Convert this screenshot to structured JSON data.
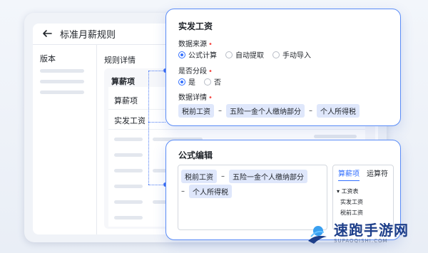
{
  "app": {
    "title": "标准月薪规则",
    "left_column_title": "版本",
    "rule_detail_title": "规则详情",
    "salary_items_title": "算薪项",
    "rows": [
      "算薪项",
      "实发工资"
    ]
  },
  "pay_panel": {
    "title": "实发工资",
    "data_source_label": "数据来源",
    "data_source_options": [
      "公式计算",
      "自动提取",
      "手动导入"
    ],
    "data_source_selected": "公式计算",
    "segmented_label": "是否分段",
    "segmented_options": [
      "是",
      "否"
    ],
    "segmented_selected": "是",
    "detail_label": "数据详情",
    "formula_tokens": [
      "税前工资",
      "五险一金个人缴纳部分",
      "个人所得税"
    ],
    "operator": "–"
  },
  "formula_panel": {
    "title": "公式编辑",
    "tokens_line1": [
      "税前工资",
      "五险一金个人缴纳部分"
    ],
    "tokens_line2": [
      "个人所得税"
    ],
    "operator": "–",
    "tabs": [
      "算薪项",
      "运算符"
    ],
    "active_tab": "算薪项",
    "tree": {
      "group": "工资表",
      "items": [
        "实发工资",
        "税前工资"
      ]
    }
  },
  "watermark": {
    "title": "速跑手游网",
    "subtitle": "SUPAOQISHI.COM"
  },
  "colors": {
    "accent": "#3370ff",
    "panel_border": "#5a8cf7",
    "tag_bg": "#dfe7fb",
    "required": "#f54a45"
  },
  "icons": [
    "back-arrow-icon",
    "radio-icon",
    "watermark-logo-icon"
  ]
}
